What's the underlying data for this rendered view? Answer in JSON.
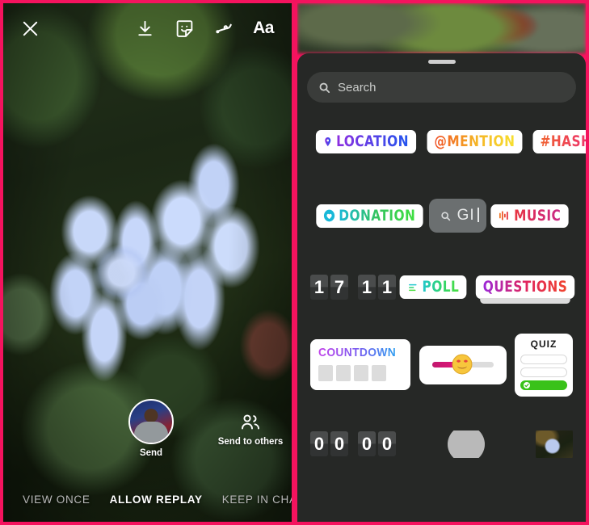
{
  "meta": {
    "border_color": "#f4135e",
    "sheet_color": "#262826"
  },
  "left_panel": {
    "name": "story-composer",
    "top_toolbar": {
      "close_icon": "close-icon",
      "actions": [
        {
          "icon": "download-icon",
          "label": "Save"
        },
        {
          "icon": "sticker-icon",
          "label": "Stickers"
        },
        {
          "icon": "draw-icon",
          "label": "Draw"
        },
        {
          "icon": "text-icon",
          "label": "Aa"
        }
      ]
    },
    "photo": {
      "description": "Two light blue plumbago flowers on dark green foliage"
    },
    "send_row": {
      "send_label": "Send",
      "send_to_others_label": "Send to others"
    },
    "modes": [
      {
        "label": "VIEW ONCE",
        "active": false
      },
      {
        "label": "ALLOW REPLAY",
        "active": true
      },
      {
        "label": "KEEP IN CHAT",
        "active": false
      }
    ]
  },
  "right_panel": {
    "name": "sticker-tray",
    "search": {
      "placeholder": "Search",
      "value": "",
      "icon": "search-icon"
    },
    "rows": [
      {
        "stickers": [
          {
            "type": "pill",
            "label": "LOCATION",
            "gradient": "g-loc",
            "icon": "pin-icon"
          },
          {
            "type": "pill",
            "label": "@MENTION",
            "gradient": "g-men"
          },
          {
            "type": "pill",
            "label": "#HASHTAG",
            "gradient": "g-hash"
          }
        ]
      },
      {
        "stickers": [
          {
            "type": "pill",
            "label": "DONATION",
            "gradient": "g-don",
            "icon": "heart-icon"
          },
          {
            "type": "gif",
            "label": "GI",
            "icon": "search-icon"
          },
          {
            "type": "pill",
            "label": "MUSIC",
            "gradient": "g-mus",
            "icon": "equalizer-icon"
          }
        ]
      },
      {
        "stickers": [
          {
            "type": "flip",
            "digits": [
              "1",
              "7",
              "1",
              "1"
            ]
          },
          {
            "type": "pill",
            "label": "POLL",
            "gradient": "g-poll",
            "icon": "poll-icon"
          },
          {
            "type": "pill",
            "label": "QUESTIONS",
            "gradient": "g-ques"
          }
        ]
      },
      {
        "stickers": [
          {
            "type": "countdown",
            "label": "COUNTDOWN",
            "gradient": "g-cdn",
            "blocks": 4
          },
          {
            "type": "slider",
            "emoji": "😍"
          },
          {
            "type": "quiz",
            "label": "QUIZ",
            "options": 3,
            "correct_index": 2
          }
        ]
      },
      {
        "stickers": [
          {
            "type": "flip",
            "digits": [
              "0",
              "0",
              "0",
              "0"
            ]
          },
          {
            "type": "circle"
          },
          {
            "type": "photo-thumb"
          }
        ]
      }
    ]
  }
}
